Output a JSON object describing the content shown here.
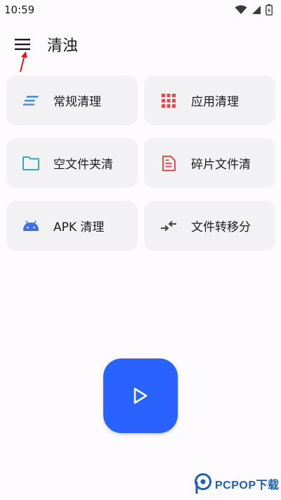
{
  "status_bar": {
    "time": "10:59",
    "icons": [
      "wifi-icon",
      "cell-signal-icon",
      "battery-icon"
    ]
  },
  "app_bar": {
    "title": "清浊",
    "menu_icon": "menu-icon"
  },
  "cards": [
    {
      "label": "常规清理",
      "icon": "lines-icon",
      "color": "#4a90d9"
    },
    {
      "label": "应用清理",
      "icon": "apps-grid-icon",
      "color": "#e5484d"
    },
    {
      "label": "空文件夹清",
      "icon": "folder-icon",
      "color": "#3aa99f"
    },
    {
      "label": "碎片文件清",
      "icon": "document-icon",
      "color": "#e05252"
    },
    {
      "label": "APK 清理",
      "icon": "android-icon",
      "color": "#3f6fe0"
    },
    {
      "label": "文件转移分",
      "icon": "transfer-arrows-icon",
      "color": "#444444"
    }
  ],
  "fab": {
    "icon": "play-icon",
    "color": "#2962ff"
  },
  "watermark": {
    "text": "PCPOP下载"
  }
}
